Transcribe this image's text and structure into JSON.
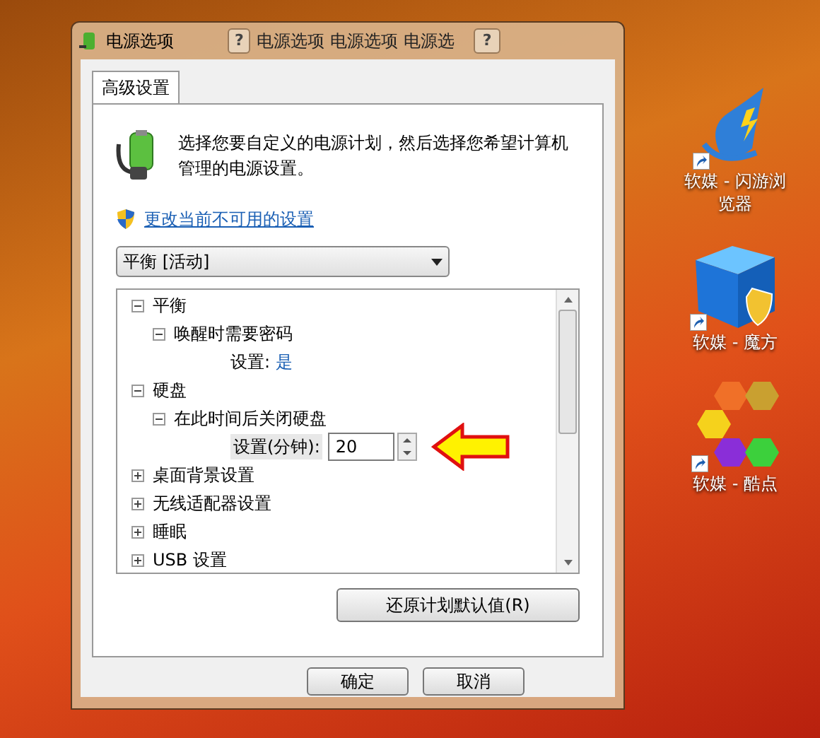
{
  "window": {
    "title": "电源选项",
    "ghost_titles": [
      "电源选项",
      "电源选项",
      "电源选"
    ],
    "help_buttons": [
      "?",
      "?"
    ]
  },
  "tabs": [
    {
      "label": "高级设置",
      "selected": true
    }
  ],
  "intro": "选择您要自定义的电源计划，然后选择您希望计算机管理的电源设置。",
  "link": "更改当前不可用的设置",
  "plan_dropdown": {
    "value": "平衡 [活动]"
  },
  "tree": [
    {
      "label": "平衡",
      "expanded": true,
      "children": [
        {
          "label": "唤醒时需要密码",
          "expanded": true,
          "children": [
            {
              "kind": "value",
              "label": "设置:",
              "value": "是"
            }
          ]
        }
      ]
    },
    {
      "label": "硬盘",
      "expanded": true,
      "children": [
        {
          "label": "在此时间后关闭硬盘",
          "expanded": true,
          "children": [
            {
              "kind": "spinner",
              "label": "设置(分钟):",
              "value": "20"
            }
          ]
        }
      ]
    },
    {
      "label": "桌面背景设置",
      "expanded": false
    },
    {
      "label": "无线适配器设置",
      "expanded": false
    },
    {
      "label": "睡眠",
      "expanded": false
    },
    {
      "label": "USB 设置",
      "expanded": false
    }
  ],
  "restore_button": "还原计划默认值(R)",
  "buttons": [
    "确定",
    "取消"
  ],
  "desktop_icons": [
    {
      "kind": "browser",
      "label": "软媒 - 闪游浏览器"
    },
    {
      "kind": "cube",
      "label": "软媒 - 魔方"
    },
    {
      "kind": "hex",
      "label": "软媒 - 酷点"
    }
  ]
}
